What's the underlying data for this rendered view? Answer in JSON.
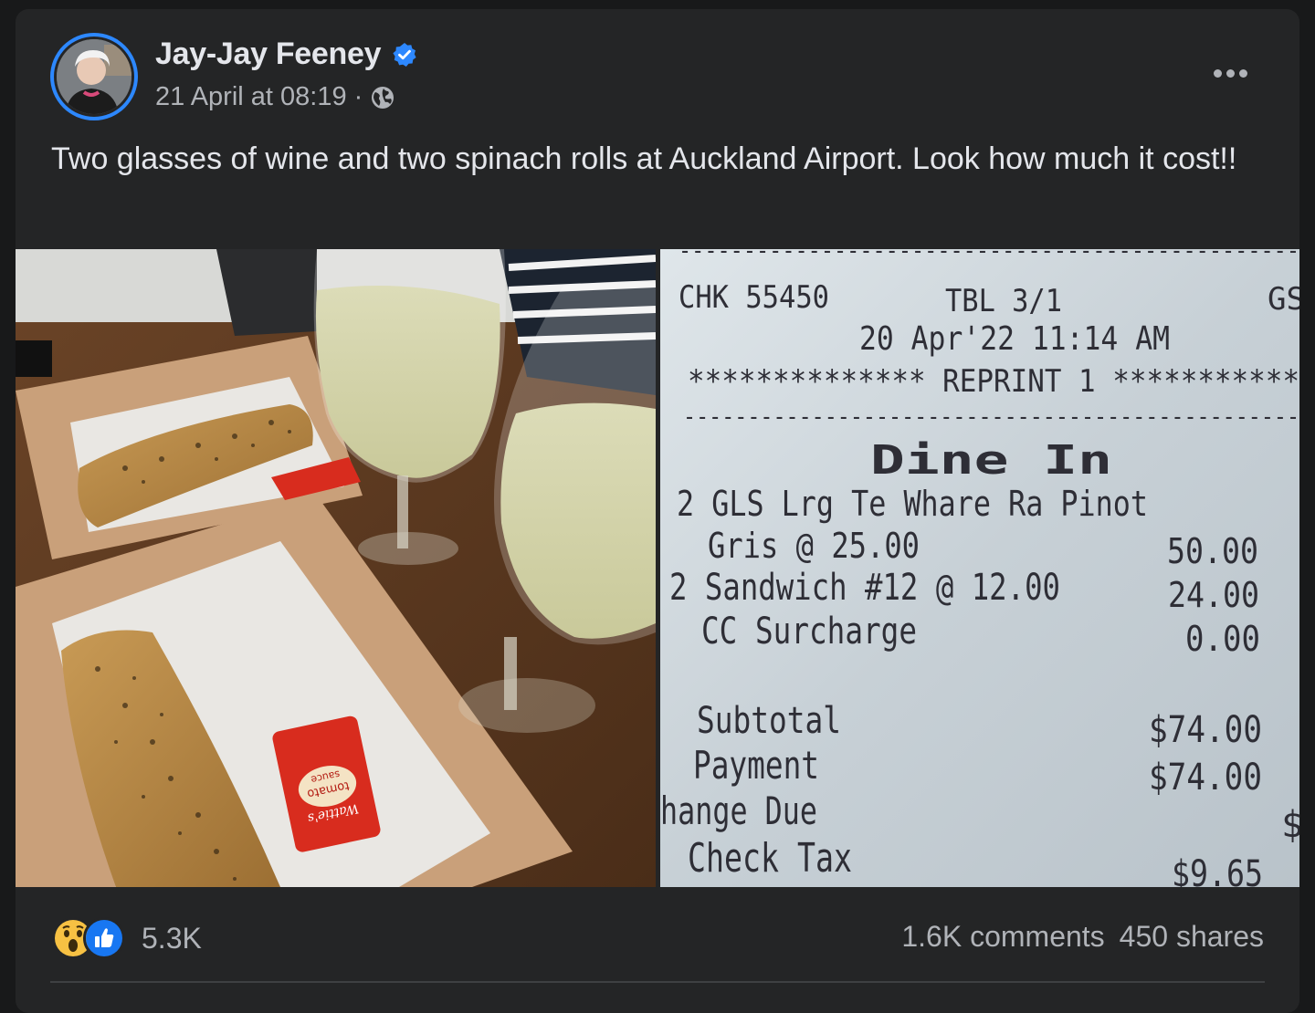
{
  "post": {
    "author": "Jay-Jay Feeney",
    "timestamp": "21 April at 08:19",
    "separator": "·",
    "verified_icon": "verified-badge-icon",
    "privacy_icon": "globe-icon",
    "text": "Two glasses of wine and two spinach rolls at Auckland Airport. Look how much it cost!!"
  },
  "photos": {
    "left": {
      "sauce_brand": "Wattie's",
      "sauce_label_line1": "tomato",
      "sauce_label_line2": "sauce"
    },
    "receipt": {
      "dashes": "------------------------------------------------",
      "chk": "CHK 55450",
      "tbl": "TBL 3/1",
      "gs": "GS",
      "datetime": "20 Apr'22 11:14 AM",
      "reprint": "************** REPRINT 1 ***********",
      "dine_in": "Dine In",
      "item1_line1": "2 GLS Lrg Te Whare Ra Pinot",
      "item1_line2": "Gris @ 25.00",
      "item1_amount": "50.00",
      "item2": "2 Sandwich #12 @ 12.00",
      "item2_amount": "24.00",
      "item3": "CC Surcharge",
      "item3_amount": "0.00",
      "subtotal_label": "Subtotal",
      "subtotal_amount": "$74.00",
      "payment_label": "Payment",
      "payment_amount": "$74.00",
      "change_label": "hange Due",
      "change_amount": "$",
      "tax_label": "Check Tax",
      "tax_amount": "$9.65"
    }
  },
  "footer": {
    "reaction_icons": [
      "wow-reaction-icon",
      "like-reaction-icon"
    ],
    "reaction_count": "5.3K",
    "comments": "1.6K comments",
    "shares": "450 shares"
  },
  "colors": {
    "page_bg": "#18191a",
    "card_bg": "#242526",
    "primary_text": "#e4e6eb",
    "secondary_text": "#b0b3b8",
    "accent_blue": "#2d88ff"
  }
}
